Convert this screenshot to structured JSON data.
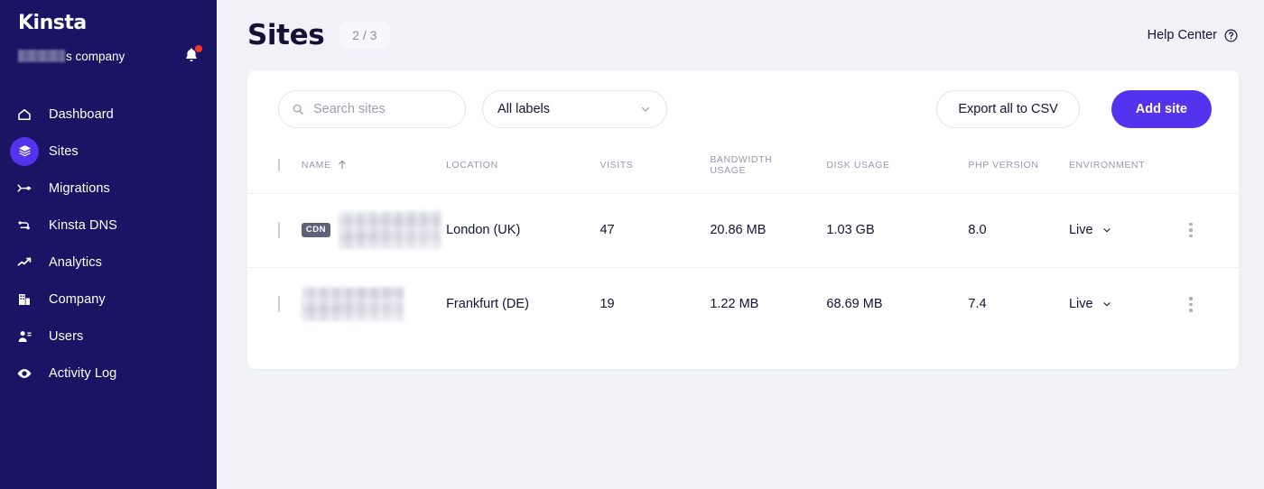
{
  "sidebar": {
    "logo": "Kinsta",
    "company_name_suffix": "s company",
    "company_redacted": true,
    "notification_badge": true,
    "items": [
      {
        "label": "Dashboard",
        "icon": "home-icon",
        "active": false
      },
      {
        "label": "Sites",
        "icon": "layers-icon",
        "active": true
      },
      {
        "label": "Migrations",
        "icon": "migrate-icon",
        "active": false
      },
      {
        "label": "Kinsta DNS",
        "icon": "dns-icon",
        "active": false
      },
      {
        "label": "Analytics",
        "icon": "analytics-icon",
        "active": false
      },
      {
        "label": "Company",
        "icon": "building-icon",
        "active": false
      },
      {
        "label": "Users",
        "icon": "user-icon",
        "active": false
      },
      {
        "label": "Activity Log",
        "icon": "eye-icon",
        "active": false
      }
    ]
  },
  "header": {
    "title": "Sites",
    "count": "2 / 3",
    "help_center": "Help Center"
  },
  "toolbar": {
    "search_placeholder": "Search sites",
    "search_value": "",
    "labels_selected": "All labels",
    "export_label": "Export all to CSV",
    "add_site_label": "Add site"
  },
  "table": {
    "columns": [
      {
        "key": "name",
        "label": "NAME",
        "sort": "asc"
      },
      {
        "key": "location",
        "label": "LOCATION"
      },
      {
        "key": "visits",
        "label": "VISITS"
      },
      {
        "key": "bandwidth",
        "label": "BANDWIDTH",
        "label2": "USAGE"
      },
      {
        "key": "disk",
        "label": "DISK USAGE"
      },
      {
        "key": "php",
        "label": "PHP VERSION"
      },
      {
        "key": "env",
        "label": "ENVIRONMENT"
      }
    ],
    "rows": [
      {
        "selected": false,
        "cdn_badge": "CDN",
        "name_redacted": true,
        "location": "London (UK)",
        "visits": "47",
        "bandwidth": "20.86 MB",
        "disk": "1.03 GB",
        "php": "8.0",
        "environment": "Live"
      },
      {
        "selected": false,
        "cdn_badge": "",
        "name_redacted": true,
        "location": "Frankfurt (DE)",
        "visits": "19",
        "bandwidth": "1.22 MB",
        "disk": "68.69 MB",
        "php": "7.4",
        "environment": "Live"
      }
    ]
  },
  "colors": {
    "sidebar_bg": "#1a1464",
    "accent": "#5333ed",
    "page_bg": "#f1f2f7",
    "text_dark": "#141337",
    "text_muted": "#9499ae",
    "notification_dot": "#f2372f",
    "cdn_badge_bg": "#5d6279"
  }
}
